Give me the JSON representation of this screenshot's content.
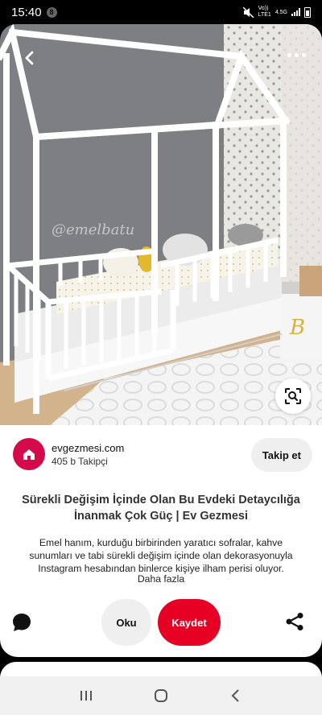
{
  "status": {
    "time": "15:40",
    "notification_count": "8",
    "network": "4.5G",
    "carrier": "LTE1",
    "vol": "Vo))"
  },
  "photo": {
    "watermark": "@emelbatu"
  },
  "creator": {
    "name": "evgezmesi.com",
    "followers": "405 b Takipçi",
    "follow_label": "Takip et"
  },
  "pin": {
    "title": "Sürekli Değişim İçinde Olan Bu Evdeki Detaycılığa İnanmak Çok Güç | Ev Gezmesi",
    "description": "Emel hanım, kurduğu birbirinden yaratıcı sofralar, kahve sunumları ve tabi sürekli değişim içinde olan dekorasyonuyla Instagram hesabından binlerce kişiye ilham perisi oluyor.",
    "more_label": "Daha fazla"
  },
  "actions": {
    "read_label": "Oku",
    "save_label": "Kaydet"
  },
  "colors": {
    "brand": "#e60023",
    "avatar": "#d40a4b"
  }
}
